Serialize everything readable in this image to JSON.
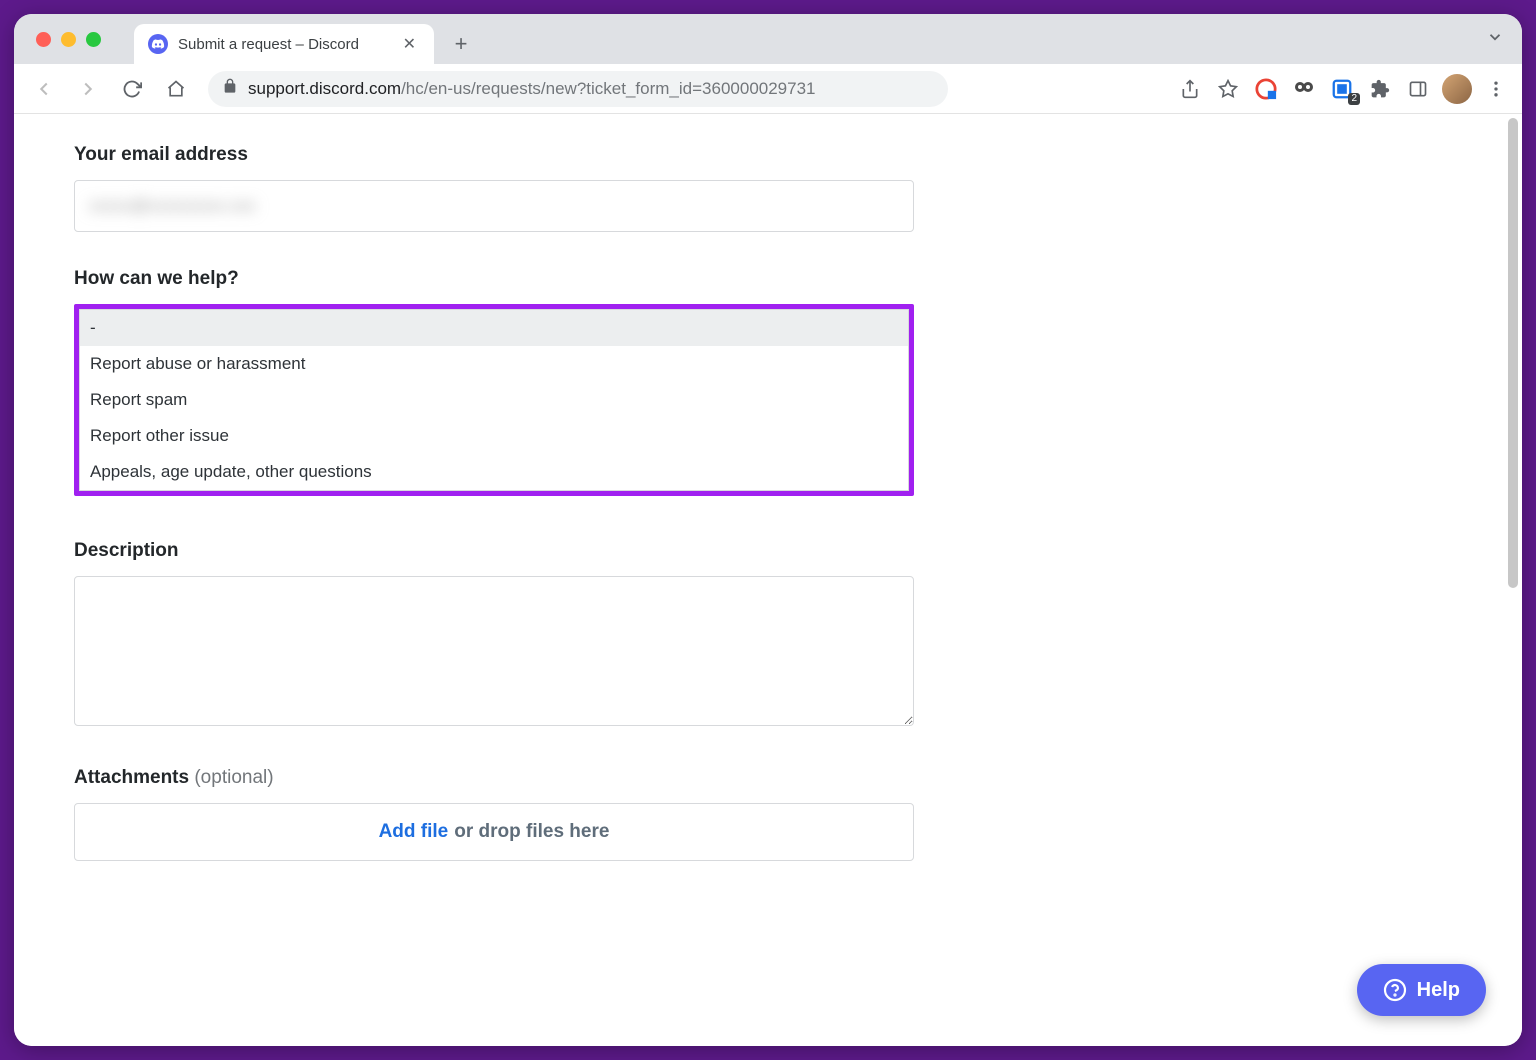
{
  "browser": {
    "tab_title": "Submit a request – Discord",
    "url_host": "support.discord.com",
    "url_path": "/hc/en-us/requests/new?ticket_form_id=360000029731",
    "ext_badge": "2"
  },
  "form": {
    "email_label": "Your email address",
    "email_value_masked": "xxxxx@xxxxxxxxx.xxx",
    "help_label": "How can we help?",
    "help_options": [
      "-",
      "Report abuse or harassment",
      "Report spam",
      "Report other issue",
      "Appeals, age update, other questions"
    ],
    "description_label": "Description",
    "description_value": "",
    "attachments_label": "Attachments",
    "attachments_optional": "(optional)",
    "dropzone_link": "Add file",
    "dropzone_rest": " or drop files here"
  },
  "help_widget": {
    "label": "Help"
  }
}
